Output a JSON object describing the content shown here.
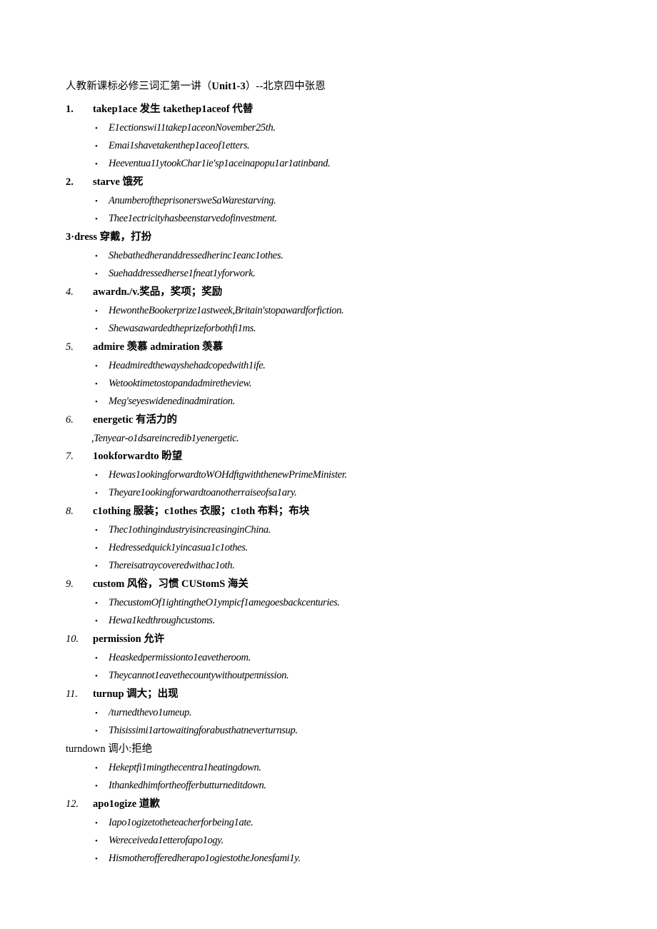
{
  "document": {
    "title_cn": "人教新课标必修三词汇第一讲（",
    "title_unit": "Unit1-3",
    "title_tail": "）--北京四中张恩",
    "title_full": "人教新课标必修三词汇第一讲（Unit1-3）--北京四中张恩",
    "bullet_glyph": "•",
    "entries": [
      {
        "number": "1.",
        "number_style": "bold-upright",
        "term": "takep1ace 发生 takethep1aceof 代替",
        "examples": [
          "E1ectionswi11takep1aceonNovember25th.",
          "Emai1shavetakenthep1aceof1etters.",
          "Heeventua11ytookChar1ie'sp1aceinapopu1ar1atinband."
        ]
      },
      {
        "number": "2.",
        "number_style": "bold-upright",
        "term": "starve 饿死",
        "examples": [
          "AnumberoftheprisonersweSaWarestarving.",
          "Thee1ectricityhasbeenstarvedofinvestment."
        ]
      },
      {
        "number": "",
        "number_style": "flush",
        "term": "3·dress 穿戴，打扮",
        "examples": [
          "Shebathedheranddressedherinc1eanc1othes.",
          "Suehaddressedherse1fneat1yforwork."
        ]
      },
      {
        "number": "4.",
        "number_style": "italic",
        "term": "awardn./v.奖品，奖项；奖励",
        "examples": [
          "HewontheBookerprize1astweek,Britain'stopawardforfiction.",
          "Shewasawardedtheprizeforbothfi1ms."
        ]
      },
      {
        "number": "5.",
        "number_style": "italic",
        "term": "admire 羡慕 admiration 羡慕",
        "examples": [
          "Headmiredthewayshehadcopedwith1ife.",
          "Wetooktimetostopandadmiretheview.",
          "Meg'seyeswidenedinadmiration."
        ]
      },
      {
        "number": "6.",
        "number_style": "italic",
        "term": "energetic 有活力的",
        "examples": [
          ",Tenyear-o1dsareincredib1yenergetic."
        ],
        "examples_no_bullet": true
      },
      {
        "number": "7.",
        "number_style": "italic",
        "term": "1ookforwardto 盼望",
        "examples": [
          "Hewas1ookingforwardtoWOHdftgwiththenewPrimeMinister.",
          "Theyare1ookingforwardtoanotherraiseofsa1ary."
        ]
      },
      {
        "number": "8.",
        "number_style": "italic",
        "term": "c1othing 服装；c1othes 衣服；c1oth 布料；布块",
        "examples": [
          "Thec1othingindustryisincreasinginChina.",
          "Hedressedquick1yincasua1c1othes.",
          "Thereisatraycoveredwithac1oth."
        ]
      },
      {
        "number": "9.",
        "number_style": "italic",
        "term": "custom 风俗，习惯 CUStomS 海关",
        "examples": [
          "ThecustomOf1ightingtheO1ympicf1amegoesbackcenturies.",
          "Hewa1kedthroughcustoms."
        ]
      },
      {
        "number": "10.",
        "number_style": "italic",
        "term": "permission 允许",
        "examples": [
          "Heaskedpermissionto1eavetheroom.",
          "Theycannot1eavethecountywithoutpeπnission."
        ]
      },
      {
        "number": "11.",
        "number_style": "italic",
        "term": "turnup 调大；出现",
        "examples": [
          "/turnedthevo1umeup.",
          "Thisissimi1artowaitingforabusthatneverturnsup."
        ]
      },
      {
        "number": "",
        "number_style": "flush-plain",
        "term": "turndown 调小:拒绝",
        "examples": [
          "Hekeptfi1mingthecentra1heatingdown.",
          "Ithankedhimfortheofferbutturneditdown."
        ]
      },
      {
        "number": "12.",
        "number_style": "italic",
        "term": "apo1ogize 道歉",
        "examples": [
          "Iapo1ogizetotheteacherforbeing1ate.",
          "Wereceiveda1etterofapo1ogy.",
          "Hismotherofferedherapo1ogiestotheJonesfami1y."
        ]
      }
    ]
  }
}
